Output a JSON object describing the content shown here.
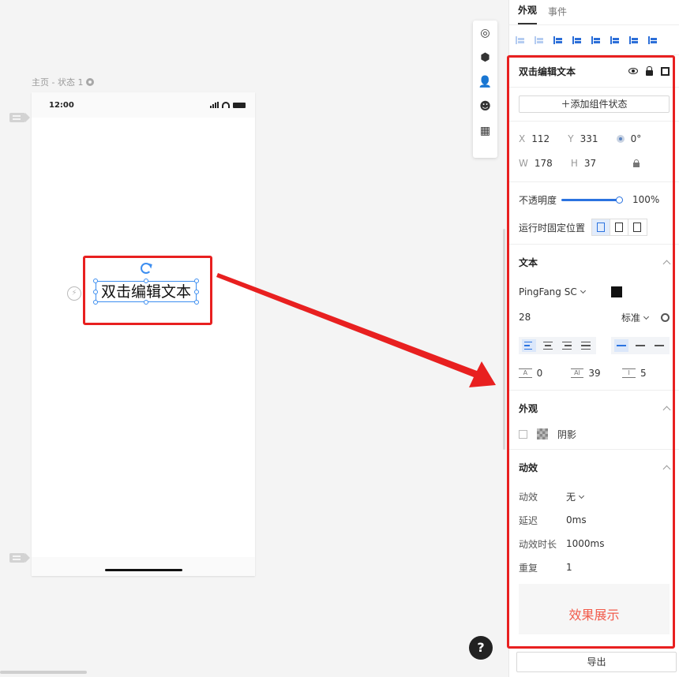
{
  "canvas": {
    "page_label": "主页 - 状态 1",
    "status_time": "12:00",
    "text_element": "双击编辑文本"
  },
  "tabs": [
    "外观",
    "事件"
  ],
  "component": {
    "title": "双击编辑文本",
    "add_state": "添加组件状态"
  },
  "geometry": {
    "x_label": "X",
    "x": "112",
    "y_label": "Y",
    "y": "331",
    "rotation": "0°",
    "w_label": "W",
    "w": "178",
    "h_label": "H",
    "h": "37"
  },
  "opacity": {
    "label": "不透明度",
    "value": "100%",
    "fill_fraction": 1.0
  },
  "fixed_position": {
    "label": "运行时固定位置"
  },
  "text_section": {
    "title": "文本",
    "font": "PingFang SC",
    "color": "#111111",
    "size": "28",
    "weight": "标准",
    "letter_spacing": "0",
    "line_height": "39",
    "paragraph_spacing": "5"
  },
  "appearance": {
    "title": "外观",
    "shadow_label": "阴影"
  },
  "animation": {
    "title": "动效",
    "effect_label": "动效",
    "effect_value": "无",
    "delay_label": "延迟",
    "delay_value": "0ms",
    "duration_label": "动效时长",
    "duration_value": "1000ms",
    "repeat_label": "重复",
    "repeat_value": "1",
    "preview": "效果展示"
  },
  "export_label": "导出",
  "help_label": "?",
  "colors": {
    "accent": "#2b73e0",
    "highlight": "#e82020",
    "preview_text": "#f25c4c"
  }
}
